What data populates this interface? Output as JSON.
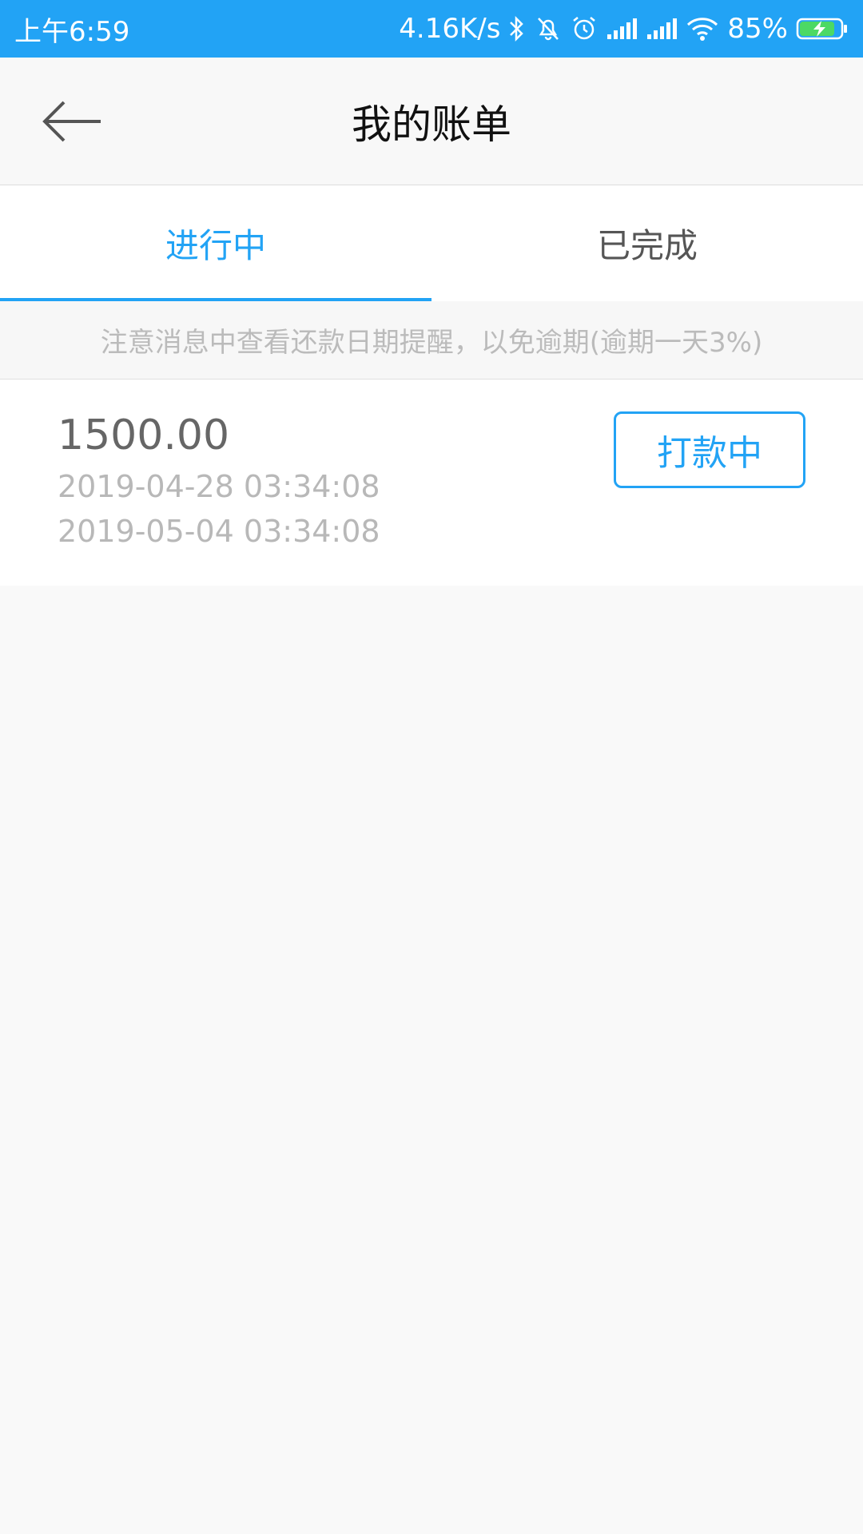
{
  "status_bar": {
    "time": "上午6:59",
    "network_speed": "4.16K/s",
    "battery_percent": "85%",
    "battery_level": 0.85,
    "icons": [
      "bluetooth-icon",
      "mute-icon",
      "alarm-icon",
      "signal-icon",
      "signal-icon",
      "wifi-icon",
      "battery-charging-icon"
    ],
    "color": "#22a3f5"
  },
  "header": {
    "title": "我的账单",
    "back_icon": "arrow-left-icon"
  },
  "tabs": [
    {
      "label": "进行中",
      "active": true
    },
    {
      "label": "已完成",
      "active": false
    }
  ],
  "notice": {
    "text": "注意消息中查看还款日期提醒，以免逾期(逾期一天3%)"
  },
  "bills": [
    {
      "amount": "1500.00",
      "start_date": "2019-04-28 03:34:08",
      "due_date": "2019-05-04 03:34:08",
      "status_label": "打款中"
    }
  ],
  "colors": {
    "accent": "#22a3f5",
    "background": "#f9f9f9"
  }
}
